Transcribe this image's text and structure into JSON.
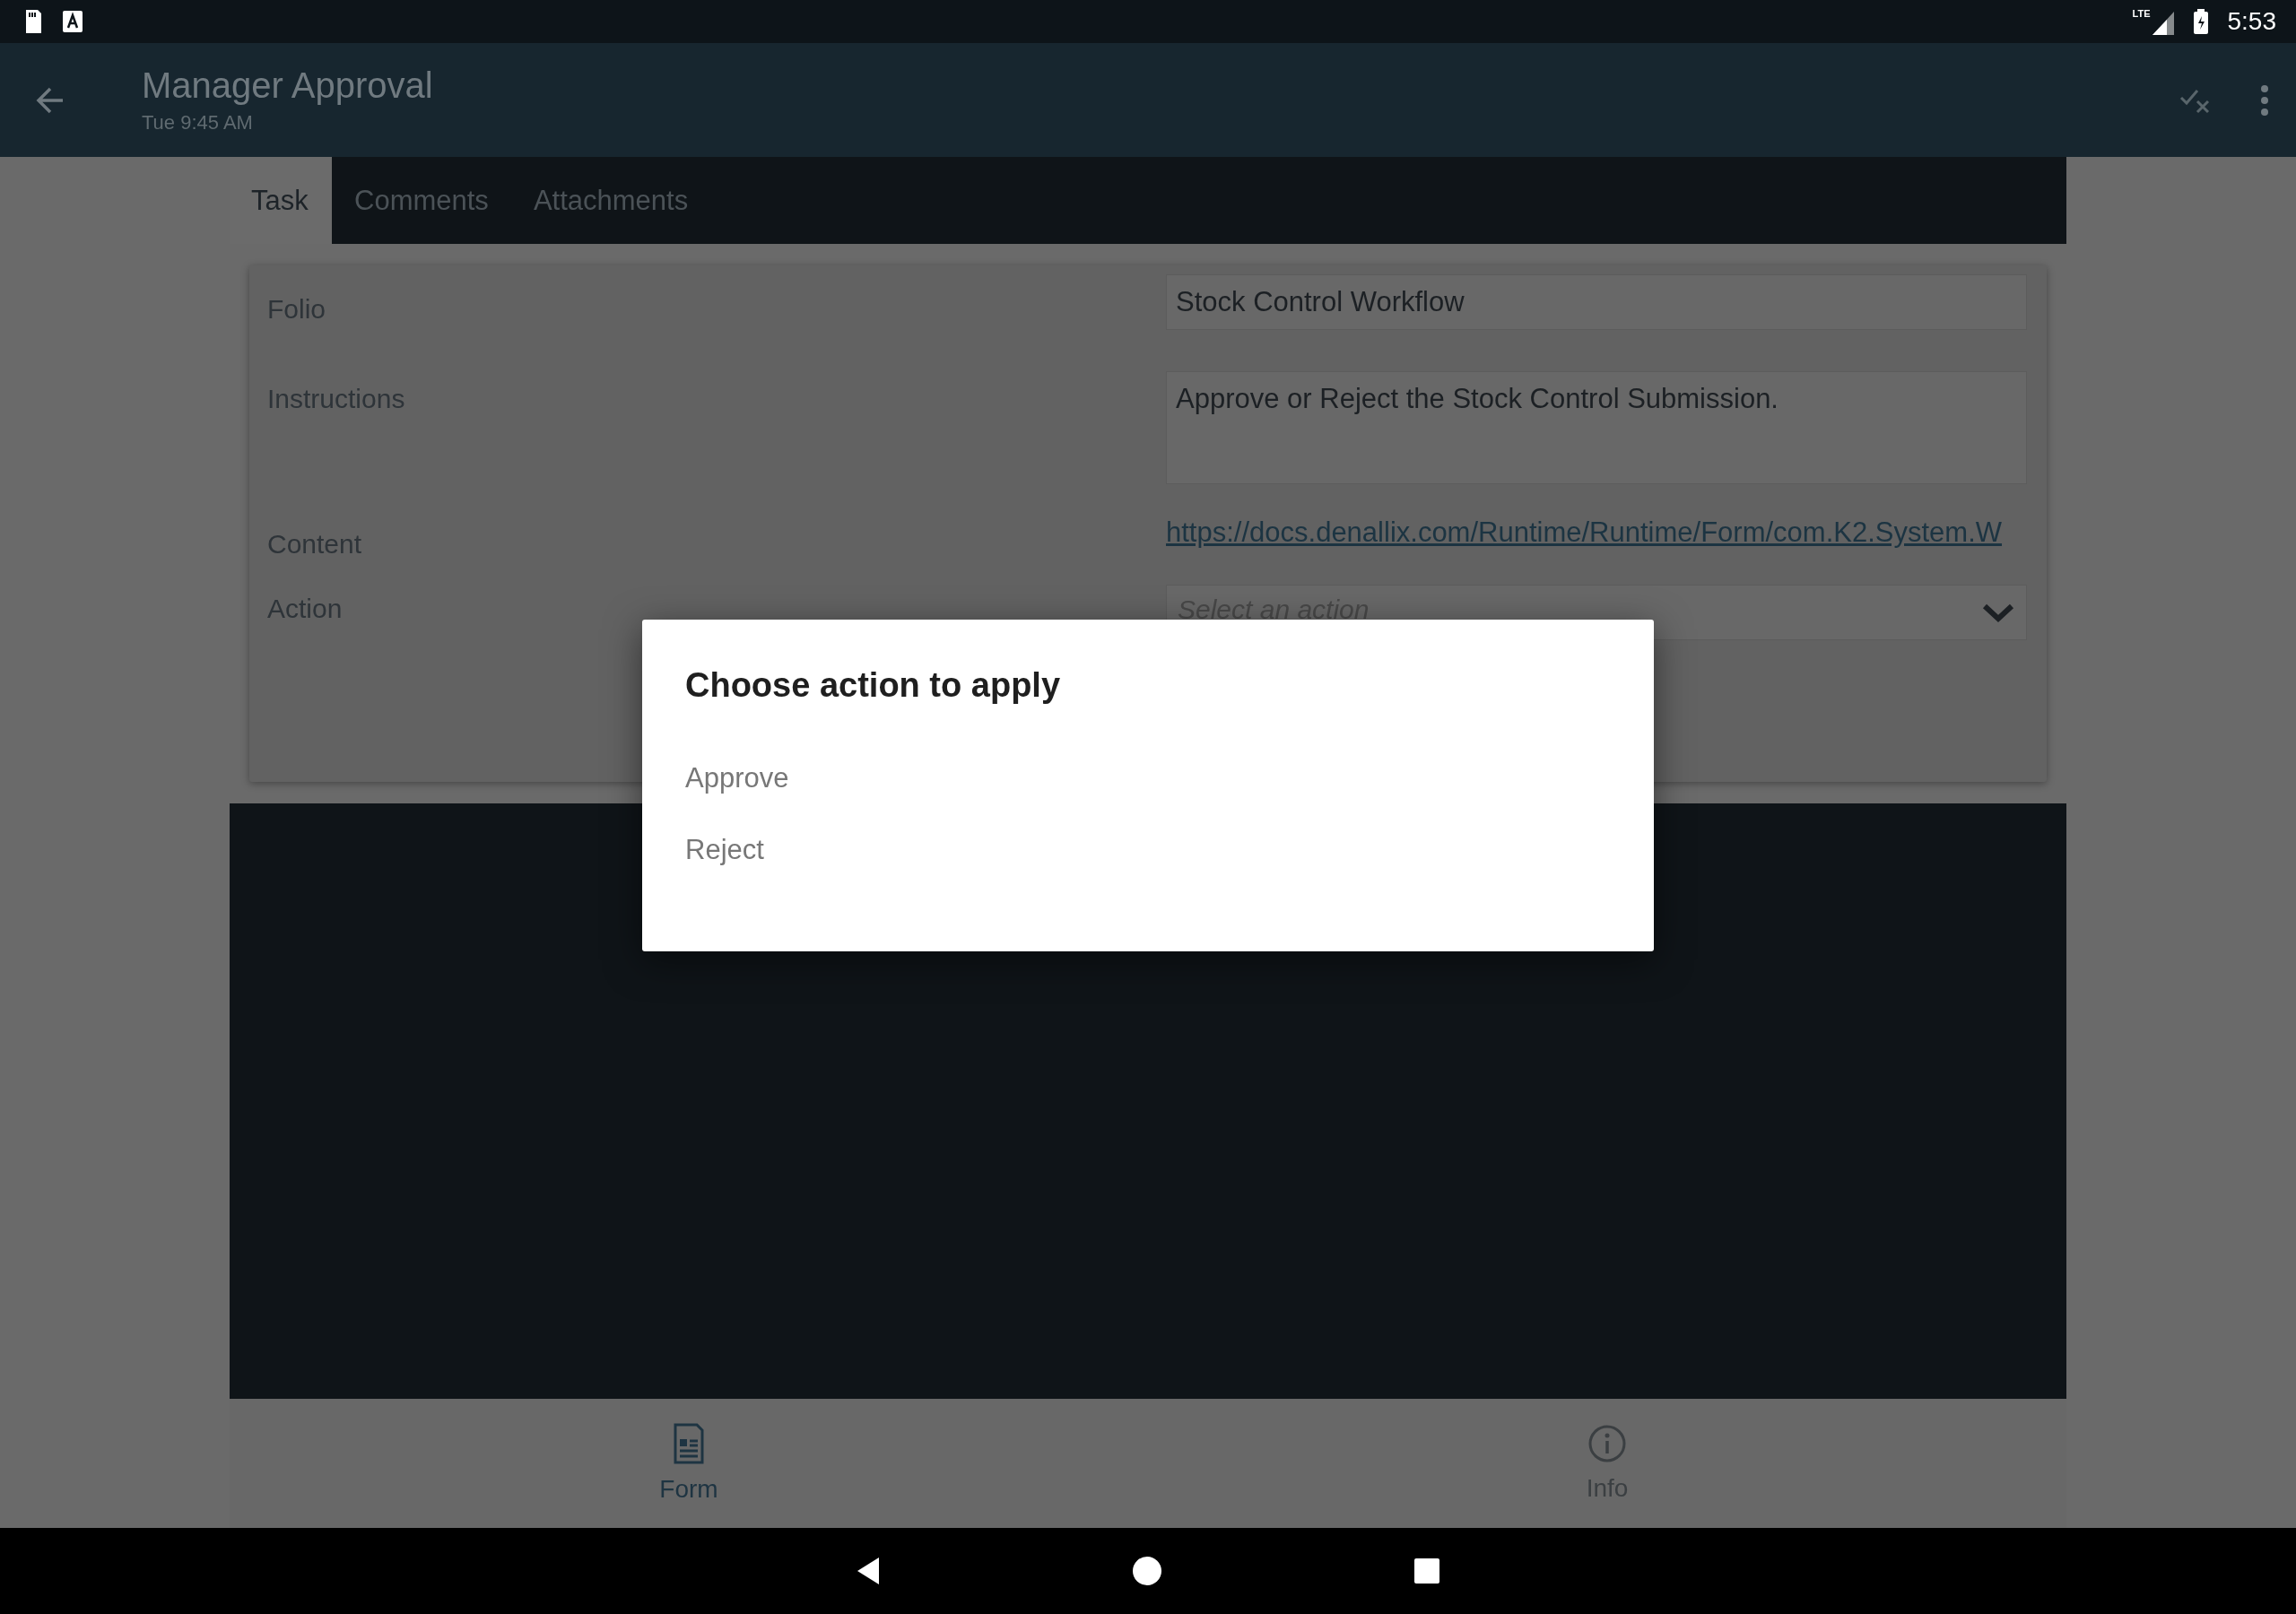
{
  "status_bar": {
    "network": "LTE",
    "time": "5:53"
  },
  "app_bar": {
    "title": "Manager Approval",
    "subtitle": "Tue 9:45 AM"
  },
  "tabs": [
    {
      "label": "Task",
      "selected": true
    },
    {
      "label": "Comments",
      "selected": false
    },
    {
      "label": "Attachments",
      "selected": false
    }
  ],
  "form": {
    "fields": [
      {
        "kind": "text",
        "label": "Folio",
        "value": "Stock Control Workflow"
      },
      {
        "kind": "textarea",
        "label": "Instructions",
        "value": "Approve or Reject the Stock Control Submission."
      },
      {
        "kind": "link",
        "label": "Content",
        "value": "https://docs.denallix.com/Runtime/Runtime/Form/com.K2.System.W"
      },
      {
        "kind": "select",
        "label": "Action",
        "placeholder": "Select an action"
      }
    ]
  },
  "dialog": {
    "title": "Choose action to apply",
    "options": [
      "Approve",
      "Reject"
    ]
  },
  "bottom_nav": [
    {
      "kind": "form",
      "label": "Form",
      "selected": true
    },
    {
      "kind": "info",
      "label": "Info",
      "selected": false
    }
  ]
}
